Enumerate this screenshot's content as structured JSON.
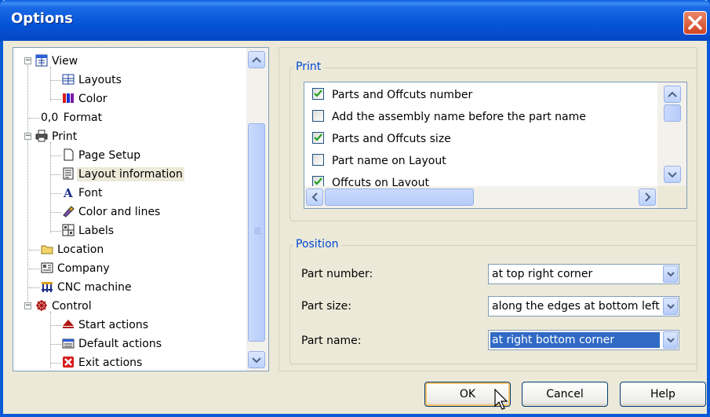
{
  "window": {
    "title": "Options"
  },
  "tree": {
    "items": [
      {
        "label": "View",
        "icon": "window-grid-icon",
        "level": 0
      },
      {
        "label": "Layouts",
        "icon": "layout-grid-icon",
        "level": 1
      },
      {
        "label": "Color",
        "icon": "color-bars-icon",
        "level": 1
      },
      {
        "label": "Format",
        "prefix": "0,0",
        "icon": "",
        "level": 0
      },
      {
        "label": "Print",
        "icon": "printer-icon",
        "level": 0
      },
      {
        "label": "Page Setup",
        "icon": "page-icon",
        "level": 1
      },
      {
        "label": "Layout information",
        "icon": "document-lines-icon",
        "level": 1
      },
      {
        "label": "Font",
        "icon": "font-a-icon",
        "level": 1
      },
      {
        "label": "Color and lines",
        "icon": "brush-icon",
        "level": 1
      },
      {
        "label": "Labels",
        "icon": "labels-grid-icon",
        "level": 1
      },
      {
        "label": "Location",
        "icon": "folder-icon",
        "level": 0
      },
      {
        "label": "Company",
        "icon": "company-card-icon",
        "level": 0
      },
      {
        "label": "CNC machine",
        "icon": "cnc-machine-icon",
        "level": 0
      },
      {
        "label": "Control",
        "icon": "control-wheel-icon",
        "level": 0
      },
      {
        "label": "Start actions",
        "icon": "start-actions-icon",
        "level": 1
      },
      {
        "label": "Default actions",
        "icon": "default-actions-icon",
        "level": 1
      },
      {
        "label": "Exit actions",
        "icon": "exit-x-icon",
        "level": 1
      }
    ],
    "selected": "Layout information"
  },
  "print_group": {
    "label": "Print",
    "options": [
      {
        "label": "Parts and Offcuts number",
        "checked": true
      },
      {
        "label": "Add the assembly name before the part name",
        "checked": false
      },
      {
        "label": "Parts and Offcuts size",
        "checked": true
      },
      {
        "label": "Part name on Layout",
        "checked": false
      },
      {
        "label": "Offcuts on Layout",
        "checked": true
      }
    ]
  },
  "position_group": {
    "label": "Position",
    "part_number": {
      "label": "Part number:",
      "value": "at top right corner"
    },
    "part_size": {
      "label": "Part size:",
      "value": "along the edges at bottom left"
    },
    "part_name": {
      "label": "Part name:",
      "value": "at right bottom corner"
    }
  },
  "buttons": {
    "ok": "OK",
    "cancel": "Cancel",
    "help": "Help"
  },
  "colors": {
    "title_bar": "#0653d8",
    "group_label": "#0046d5",
    "selection": "#316ac5",
    "check": "#21a121"
  }
}
